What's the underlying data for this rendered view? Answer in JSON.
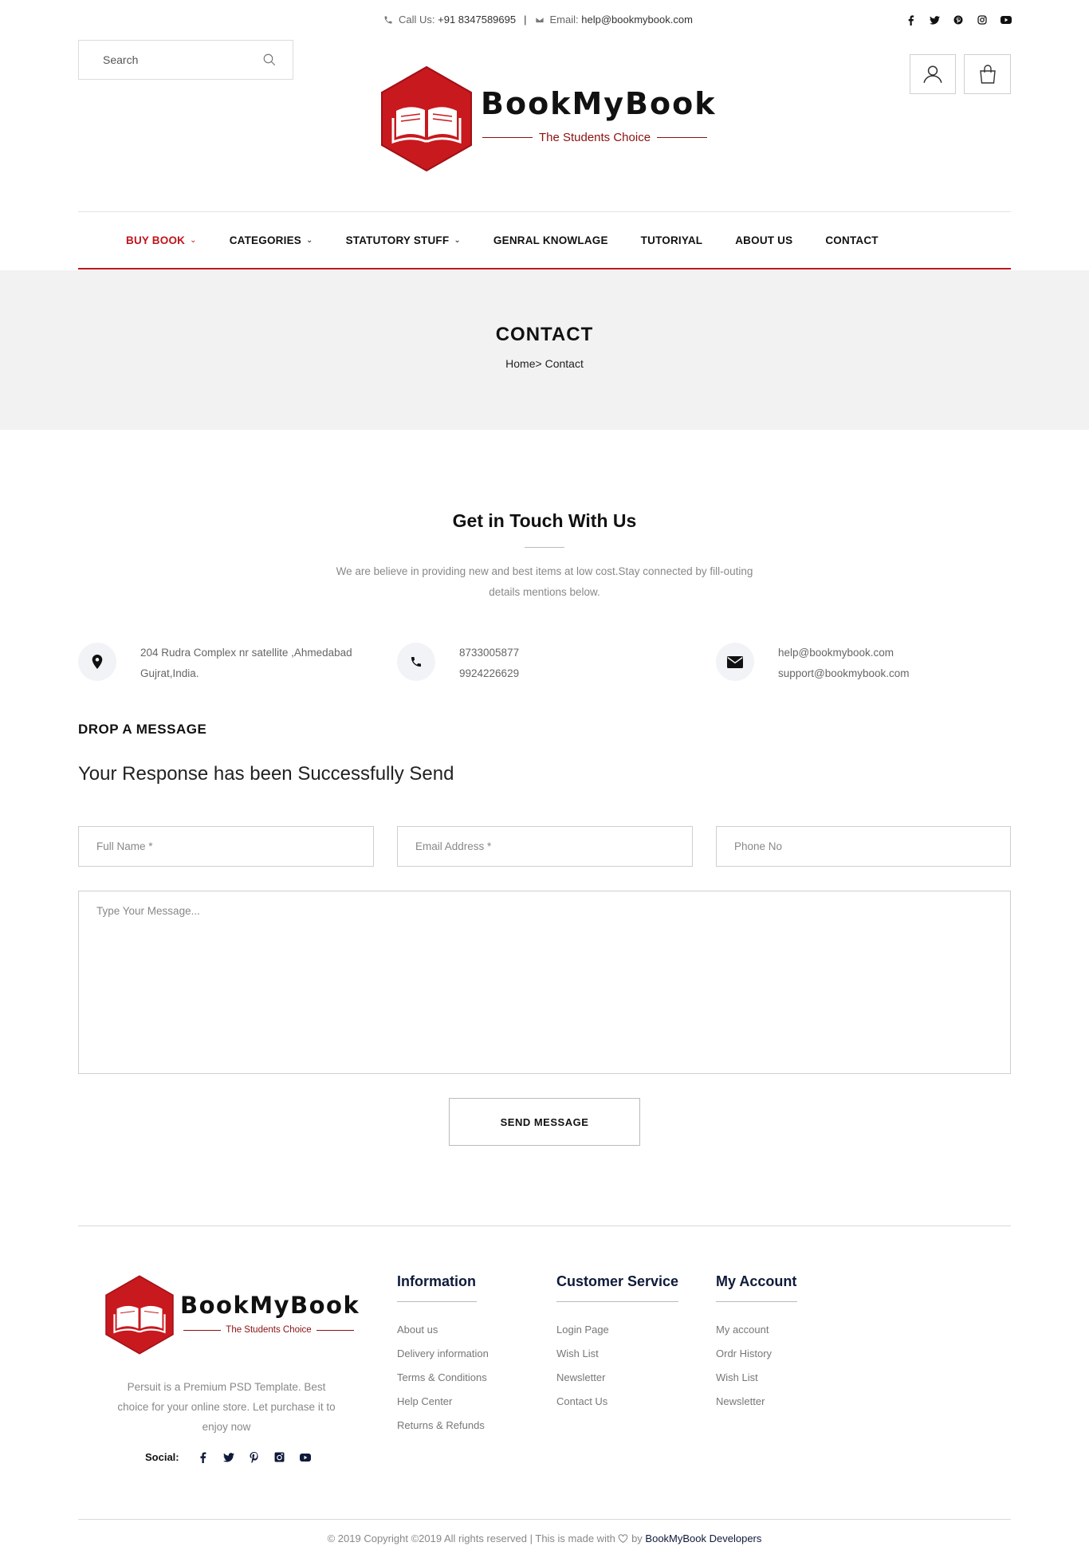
{
  "topbar": {
    "call_label": "Call Us:",
    "phone": "+91 8347589695",
    "separator": "|",
    "email_label": "Email:",
    "email": "help@bookmybook.com",
    "social_icons": [
      "facebook-icon",
      "twitter-icon",
      "pinterest-icon",
      "instagram-icon",
      "youtube-icon"
    ]
  },
  "search": {
    "placeholder": "Search"
  },
  "brand": {
    "name": "BookMyBook",
    "tagline": "The Students Choice",
    "color": "#c0141c"
  },
  "nav": {
    "items": [
      {
        "label": "BUY BOOK",
        "active": true,
        "dropdown": true
      },
      {
        "label": "CATEGORIES",
        "active": false,
        "dropdown": true
      },
      {
        "label": "STATUTORY STUFF",
        "active": false,
        "dropdown": true
      },
      {
        "label": "GENRAL KNOWLAGE",
        "active": false,
        "dropdown": false
      },
      {
        "label": "TUTORIYAL",
        "active": false,
        "dropdown": false
      },
      {
        "label": "ABOUT US",
        "active": false,
        "dropdown": false
      },
      {
        "label": "CONTACT",
        "active": false,
        "dropdown": false
      }
    ],
    "chevron": "⌄"
  },
  "banner": {
    "title": "CONTACT",
    "crumb_home": "Home",
    "crumb_sep": ">",
    "crumb_current": "Contact"
  },
  "touch": {
    "title": "Get in Touch With Us",
    "subtitle": "We are believe in providing new and best items at low cost.Stay connected by fill-outing details mentions below."
  },
  "info": {
    "address": [
      "204 Rudra Complex nr satellite ,Ahmedabad",
      "Gujrat,India."
    ],
    "phones": [
      "8733005877",
      "9924226629"
    ],
    "emails": [
      "help@bookmybook.com",
      "support@bookmybook.com"
    ]
  },
  "form": {
    "heading": "DROP A MESSAGE",
    "response": "Your Response has been Successfully Send",
    "full_name_placeholder": "Full Name *",
    "email_placeholder": "Email Address *",
    "phone_placeholder": "Phone No",
    "message_placeholder": "Type Your Message...",
    "send_label": "SEND MESSAGE"
  },
  "footer": {
    "description": "Persuit is a Premium PSD Template. Best choice for your online store. Let purchase it to enjoy now",
    "social_label": "Social:",
    "columns": [
      {
        "title": "Information",
        "links": [
          "About us",
          "Delivery information",
          "Terms & Conditions",
          "Help Center",
          "Returns & Refunds"
        ]
      },
      {
        "title": "Customer Service",
        "links": [
          "Login Page",
          "Wish List",
          "Newsletter",
          "Contact Us"
        ]
      },
      {
        "title": "My Account",
        "links": [
          "My account",
          "Ordr History",
          "Wish List",
          "Newsletter"
        ]
      }
    ],
    "copyright": "© 2019 Copyright ©2019 All rights reserved | This is made with",
    "copyright_by": "by",
    "developer": "BookMyBook Developers"
  }
}
